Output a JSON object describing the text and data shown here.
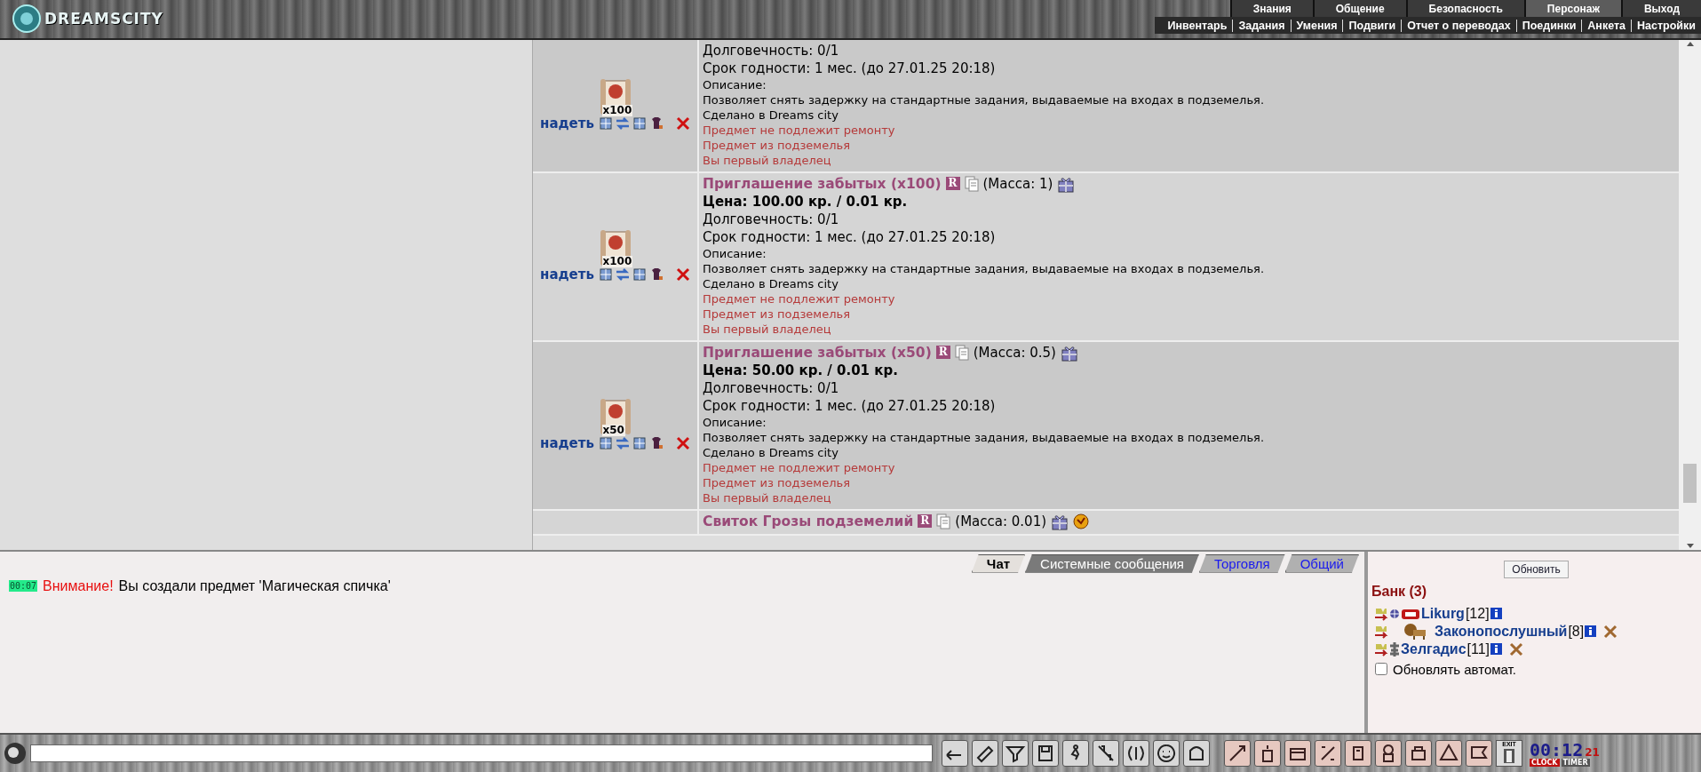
{
  "header": {
    "logo": "DREAMSCITY",
    "menu": [
      {
        "label": "Знания",
        "selected": false
      },
      {
        "label": "Общение",
        "selected": false
      },
      {
        "label": "Безопасность",
        "selected": false
      },
      {
        "label": "Персонаж",
        "selected": true
      },
      {
        "label": "Выход",
        "selected": false
      }
    ],
    "submenu": [
      "Инвентарь",
      "Задания",
      "Умения",
      "Подвиги",
      "Отчет о переводах",
      "Поединки",
      "Анкета",
      "Настройки"
    ]
  },
  "items": [
    {
      "quantity": "x100",
      "action": "надеть",
      "durability": "Долговечность: 0/1",
      "expiry": "Срок годности: 1 мес. (до 27.01.25 20:18)",
      "description_label": "Описание:",
      "description": "Позволяет снять задержку на стандартные задания, выдаваемые на входах в подземелья.",
      "maker": "Сделано в Dreams city",
      "notes": [
        "Предмет не подлежит ремонту",
        "Предмет из подземелья",
        "Вы первый владелец"
      ]
    },
    {
      "quantity": "x100",
      "action": "надеть",
      "title": "Приглашение забытых (x100)",
      "badge": "R",
      "mass": "(Масса: 1)",
      "orb": false,
      "price": "Цена: 100.00 кр. / 0.01 кр.",
      "durability": "Долговечность: 0/1",
      "expiry": "Срок годности: 1 мес. (до 27.01.25 20:18)",
      "description_label": "Описание:",
      "description": "Позволяет снять задержку на стандартные задания, выдаваемые на входах в подземелья.",
      "maker": "Сделано в Dreams city",
      "notes": [
        "Предмет не подлежит ремонту",
        "Предмет из подземелья",
        "Вы первый владелец"
      ]
    },
    {
      "quantity": "x50",
      "action": "надеть",
      "title": "Приглашение забытых (x50)",
      "badge": "R",
      "mass": "(Масса: 0.5)",
      "orb": false,
      "price": "Цена: 50.00 кр. / 0.01 кр.",
      "durability": "Долговечность: 0/1",
      "expiry": "Срок годности: 1 мес. (до 27.01.25 20:18)",
      "description_label": "Описание:",
      "description": "Позволяет снять задержку на стандартные задания, выдаваемые на входах в подземелья.",
      "maker": "Сделано в Dreams city",
      "notes": [
        "Предмет не подлежит ремонту",
        "Предмет из подземелья",
        "Вы первый владелец"
      ]
    },
    {
      "title": "Свиток Грозы подземелий",
      "badge": "R",
      "mass": "(Масса: 0.01)",
      "orb": true
    }
  ],
  "chat": {
    "tabs": [
      {
        "label": "Чат",
        "selected": true,
        "kind": "plain"
      },
      {
        "label": "Системные сообщения",
        "selected": false,
        "kind": "dark"
      },
      {
        "label": "Торговля",
        "selected": false,
        "kind": "channel"
      },
      {
        "label": "Общий",
        "selected": false,
        "kind": "channel"
      }
    ],
    "messages": [
      {
        "time": "00:07",
        "alert": "Внимание!",
        "text": "Вы создали предмет 'Магическая спичка'"
      }
    ]
  },
  "online": {
    "refresh": "Обновить",
    "title": "Банк (3)",
    "players": [
      {
        "kind": "clan",
        "name": "Likurg",
        "rank": "[12]",
        "removable": false
      },
      {
        "kind": "lion",
        "name": "Законопослушный",
        "rank": "[8]",
        "removable": true
      },
      {
        "kind": "plain",
        "name": "Зелгадис",
        "rank": "[11]",
        "removable": true
      }
    ],
    "auto_refresh": {
      "label": "Обновлять автомат.",
      "checked": false
    }
  },
  "toolbar": {
    "exit_label": "EXIT",
    "clock": "00:12",
    "seconds": "21",
    "clock_label": "CLOCK",
    "timer_label": "TIMER"
  }
}
